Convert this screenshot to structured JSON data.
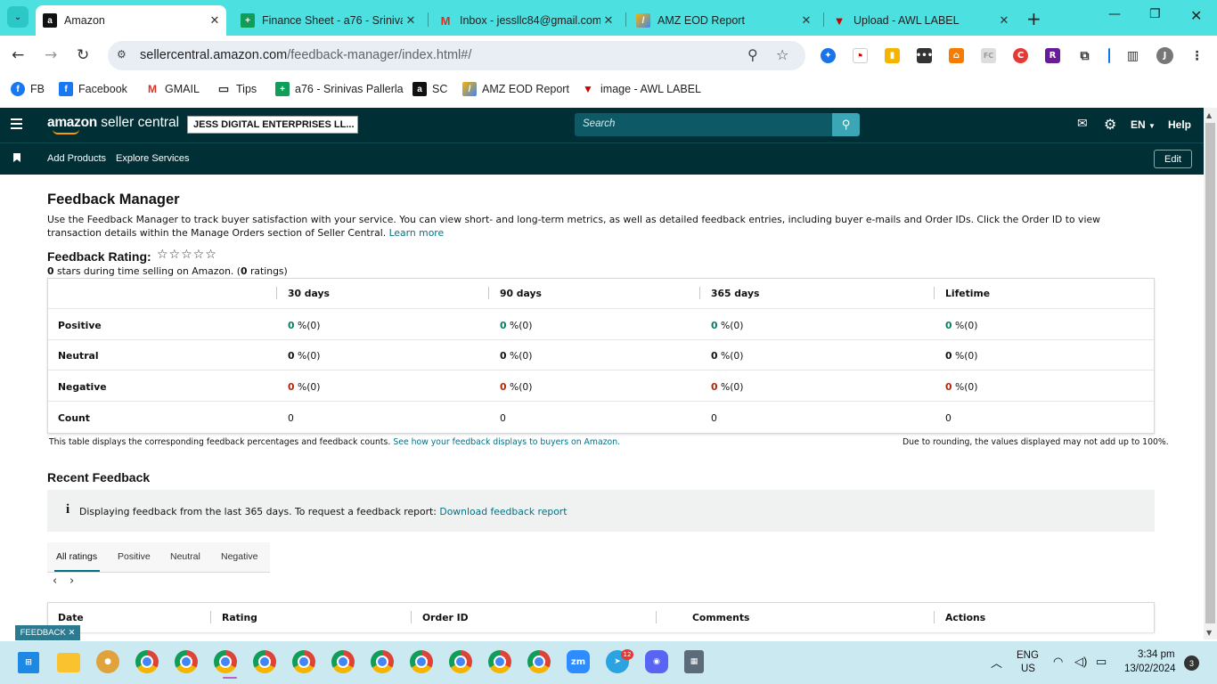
{
  "browser": {
    "tabs": [
      {
        "title": "Amazon",
        "active": true
      },
      {
        "title": "Finance Sheet - a76 - Sriniva",
        "active": false
      },
      {
        "title": "Inbox - jessllc84@gmail.com",
        "active": false
      },
      {
        "title": "AMZ EOD Report",
        "active": false
      },
      {
        "title": "Upload - AWL LABEL",
        "active": false
      }
    ],
    "url_domain": "sellercentral.amazon.com",
    "url_path": "/feedback-manager/index.html#/",
    "profile_initial": "J",
    "bookmarks": [
      "FB",
      "Facebook",
      "GMAIL",
      "Tips",
      "a76 - Srinivas Pallerla",
      "SC",
      "AMZ EOD Report",
      "image - AWL LABEL"
    ]
  },
  "header": {
    "logo_amazon": "amazon",
    "logo_rest": "seller central",
    "account": "JESS DIGITAL ENTERPRISES LL...",
    "search_placeholder": "Search",
    "language": "EN",
    "help": "Help",
    "sub_links": [
      "Add Products",
      "Explore Services"
    ],
    "edit": "Edit"
  },
  "page": {
    "title": "Feedback Manager",
    "description": "Use the Feedback Manager to track buyer satisfaction with your service. You can view short- and long-term metrics, as well as detailed feedback entries, including buyer e-mails and Order IDs. Click the Order ID to view transaction details within the Manage Orders section of Seller Central.",
    "learn_more": "Learn more",
    "rating_label": "Feedback Rating:",
    "rating_stars": "☆☆☆☆☆",
    "rating_value": "0",
    "rating_sub_mid": " stars during time selling on Amazon. (",
    "rating_count": "0",
    "rating_sub_end": " ratings)",
    "table": {
      "columns": [
        "30 days",
        "90 days",
        "365 days",
        "Lifetime"
      ],
      "rows": [
        {
          "label": "Positive",
          "values": [
            "0",
            "0",
            "0",
            "0"
          ],
          "suffix": " %(0)"
        },
        {
          "label": "Neutral",
          "values": [
            "0",
            "0",
            "0",
            "0"
          ],
          "suffix": " %(0)"
        },
        {
          "label": "Negative",
          "values": [
            "0",
            "0",
            "0",
            "0"
          ],
          "suffix": " %(0)"
        },
        {
          "label": "Count",
          "values": [
            "0",
            "0",
            "0",
            "0"
          ],
          "suffix": ""
        }
      ]
    },
    "note_left": "This table displays the corresponding feedback percentages and feedback counts.",
    "note_link": "See how your feedback displays to buyers on Amazon.",
    "note_right": "Due to rounding, the values displayed may not add up to 100%.",
    "recent_title": "Recent Feedback",
    "info_text": "Displaying feedback from the last 365 days. To request a feedback report:",
    "info_link": "Download feedback report",
    "filter_tabs": [
      "All ratings",
      "Positive",
      "Neutral",
      "Negative"
    ],
    "list_columns": [
      "Date",
      "Rating",
      "Order ID",
      "Comments",
      "Actions"
    ],
    "feedback_button": "FEEDBACK ✕"
  },
  "taskbar": {
    "lang": "ENG",
    "region": "US",
    "time": "3:34 pm",
    "date": "13/02/2024",
    "notifications": "3",
    "telegram_badge": "12"
  }
}
